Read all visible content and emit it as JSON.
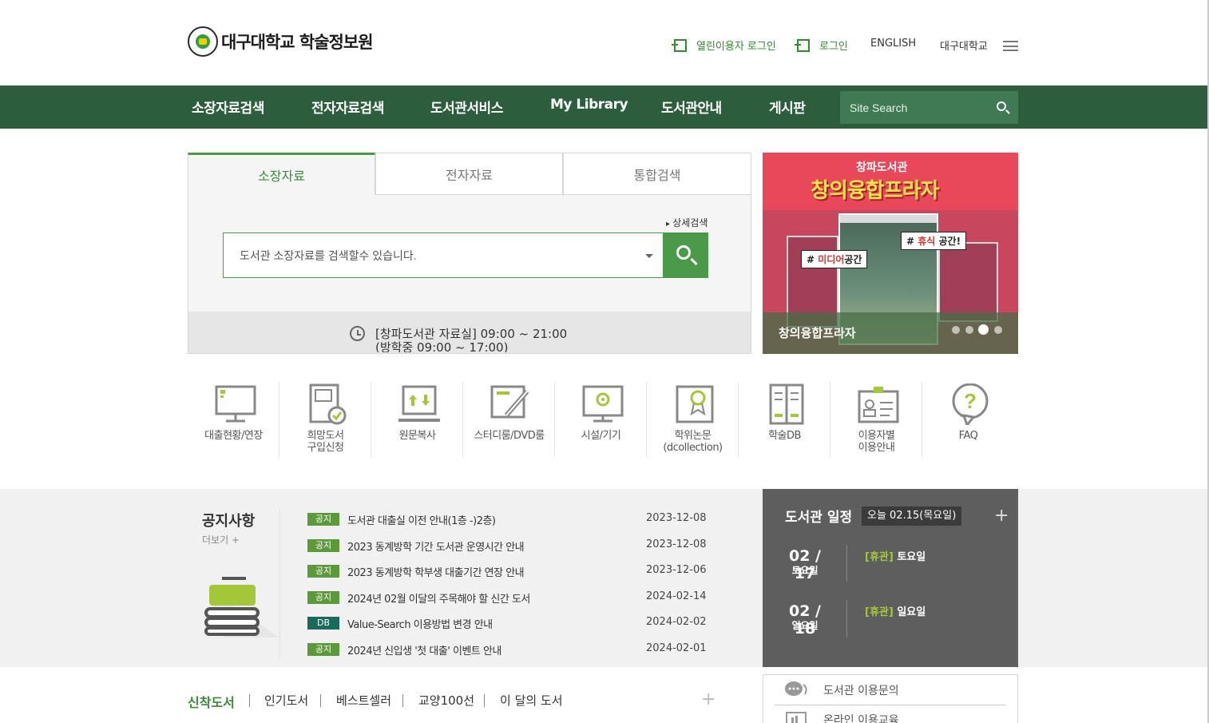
{
  "header": {
    "logo_text": "대구대학교 학술정보원",
    "open_user_login": "열린이용자 로그인",
    "login": "로그인",
    "english": "ENGLISH",
    "univ": "대구대학교"
  },
  "gnb": {
    "items": [
      "소장자료검색",
      "전자자료검색",
      "도서관서비스",
      "My Library",
      "도서관안내",
      "게시판"
    ],
    "search_placeholder": "Site Search"
  },
  "search": {
    "tabs": [
      "소장자료",
      "전자자료",
      "통합검색"
    ],
    "advanced": "상세검색",
    "placeholder": "도서관 소장자료를 검색할수 있습니다.",
    "hours_line1": "[창파도서관 자료실] 09:00 ~ 21:00",
    "hours_line2": "(방학중 09:00 ~ 17:00)"
  },
  "banner": {
    "sub": "창파도서관",
    "title": "창의융합프라자",
    "tag_rest": "휴식",
    "tag_rest_suffix": " 공간!",
    "tag_media": "미디어",
    "tag_media_suffix": "공간",
    "caption": "창의융합프라자",
    "slide_count": 4,
    "active_slide": 3
  },
  "quick_menu": [
    {
      "line1": "대출현황/연장",
      "line2": "",
      "icon": "monitor-icon"
    },
    {
      "line1": "희망도서",
      "line2": "구입신청",
      "icon": "book-check-icon"
    },
    {
      "line1": "원문복사",
      "line2": "",
      "icon": "laptop-arrows-icon"
    },
    {
      "line1": "스터디룸/DVD룸",
      "line2": "",
      "icon": "pencil-board-icon"
    },
    {
      "line1": "시설/기기",
      "line2": "",
      "icon": "monitor-gear-icon"
    },
    {
      "line1": "학위논문",
      "line2": "(dcollection)",
      "icon": "certificate-icon"
    },
    {
      "line1": "학술DB",
      "line2": "",
      "icon": "journal-icon"
    },
    {
      "line1": "이용자별",
      "line2": "이용안내",
      "icon": "id-card-icon"
    },
    {
      "line1": "FAQ",
      "line2": "",
      "icon": "question-bubble-icon"
    }
  ],
  "notice": {
    "title": "공지사항",
    "more": "더보기 +",
    "items": [
      {
        "badge": "공지",
        "title": "도서관 대출실 이전 안내(1층 -)2층)",
        "date": "2023-12-08"
      },
      {
        "badge": "공지",
        "title": "2023 동계방학 기간 도서관 운영시간 안내",
        "date": "2023-12-08"
      },
      {
        "badge": "공지",
        "title": "2023 동계방학 학부생 대출기간 연장 안내",
        "date": "2023-12-06"
      },
      {
        "badge": "공지",
        "title": "2024년 02월 이달의 주목해야 할 신간 도서",
        "date": "2024-02-14"
      },
      {
        "badge": "DB",
        "title": "Value-Search 이용방법 변경 안내",
        "date": "2024-02-02"
      },
      {
        "badge": "공지",
        "title": "2024년 신입생 '첫 대출' 이벤트 안내",
        "date": "2024-02-01"
      }
    ]
  },
  "schedule": {
    "title": "도서관 일정",
    "today": "오늘 02.15(목요일)",
    "plus": "+",
    "events": [
      {
        "date": "02 / 17",
        "day": "토요일",
        "kind": "[휴관]",
        "text": " 토요일"
      },
      {
        "date": "02 / 18",
        "day": "일요일",
        "kind": "[휴관]",
        "text": " 일요일"
      }
    ]
  },
  "book_tabs": [
    "신착도서",
    "인기도서",
    "베스트셀러",
    "교양100선",
    "이 달의 도서"
  ],
  "inquiry": {
    "item1": "도서관 이용문의",
    "item2": "온라인 이용교육"
  },
  "colors": {
    "nav_green": "#2c5e3d",
    "accent_green": "#4a9a4a",
    "schedule_gray": "#5e5e5e",
    "banner_red": "#e8485a"
  }
}
